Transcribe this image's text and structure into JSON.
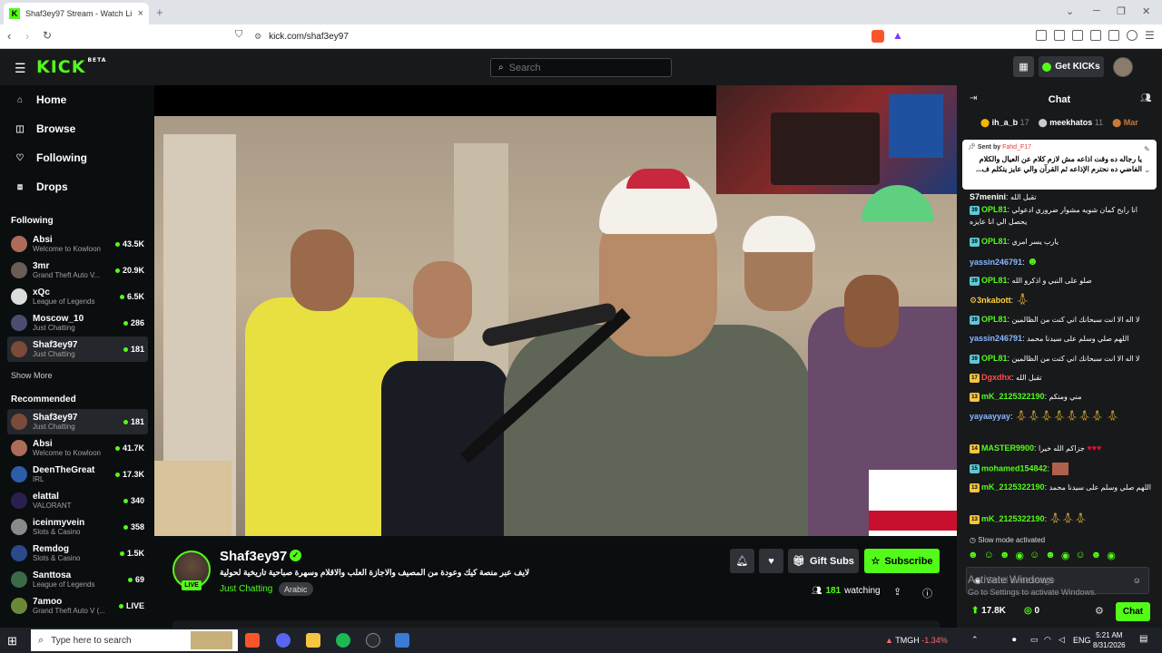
{
  "browser": {
    "tab_title": "Shaf3ey97 Stream - Watch Li",
    "tab_close": "×",
    "new_tab": "+",
    "url": "kick.com/shaf3ey97"
  },
  "kick": {
    "logo": "KICK",
    "logo_badge": "BETA",
    "search_placeholder": "Search",
    "get_kicks": "Get KICKs"
  },
  "sidebar": {
    "nav": [
      {
        "label": "Home",
        "icon": "home-icon"
      },
      {
        "label": "Browse",
        "icon": "browse-icon"
      },
      {
        "label": "Following",
        "icon": "heart-icon"
      },
      {
        "label": "Drops",
        "icon": "gift-icon"
      }
    ],
    "following_header": "Following",
    "following": [
      {
        "name": "Absi",
        "category": "Welcome to Kowloon",
        "viewers": "43.5K"
      },
      {
        "name": "3mr",
        "category": "Grand Theft Auto V...",
        "viewers": "20.9K"
      },
      {
        "name": "xQc",
        "category": "League of Legends",
        "viewers": "6.5K"
      },
      {
        "name": "Moscow_10",
        "category": "Just Chatting",
        "viewers": "286"
      },
      {
        "name": "Shaf3ey97",
        "category": "Just Chatting",
        "viewers": "181"
      }
    ],
    "show_more": "Show More",
    "recommended_header": "Recommended",
    "recommended": [
      {
        "name": "Shaf3ey97",
        "category": "Just Chatting",
        "viewers": "181"
      },
      {
        "name": "Absi",
        "category": "Welcome to Kowloon",
        "viewers": "41.7K"
      },
      {
        "name": "DeenTheGreat",
        "category": "IRL",
        "viewers": "17.3K"
      },
      {
        "name": "elattal",
        "category": "VALORANT",
        "viewers": "340"
      },
      {
        "name": "iceinmyvein",
        "category": "Slots & Casino",
        "viewers": "358"
      },
      {
        "name": "Remdog",
        "category": "Slots & Casino",
        "viewers": "1.5K"
      },
      {
        "name": "Santtosa",
        "category": "League of Legends",
        "viewers": "69"
      },
      {
        "name": "7amoo",
        "category": "Grand Theft Auto V (...",
        "viewers": "LIVE"
      }
    ]
  },
  "stream": {
    "streamer": "Shaf3ey97",
    "live_badge": "LIVE",
    "title": "لايف عبر منصة كيك وعودة من المصيف والاجازة العلب والاقلام وسهرة صباحية تاريخية لحولية",
    "category": "Just Chatting",
    "language": "Arabic",
    "gift_subs": "Gift Subs",
    "subscribe": "Subscribe",
    "viewers": "181",
    "watching_label": "watching"
  },
  "chat": {
    "header": "Chat",
    "leaders": [
      {
        "name": "ih_a_b",
        "count": "17"
      },
      {
        "name": "meekhatos",
        "count": "11"
      },
      {
        "name": "Mar",
        "count": ""
      }
    ],
    "pinned_by_label": "Sent by",
    "pinned_by_user": "Fahd_F17",
    "pinned_message": "يا رجاله ده وقت اذاعه مش لازم كلام عن العيال والكلام الفاضي ده نحترم الإذاعه ثم القرآن والي عايز يتكلم ف...",
    "messages": [
      {
        "badge": "",
        "user": "S7menini",
        "text": "تقبل الله",
        "color": "#ffffff"
      },
      {
        "badge": "39",
        "user": "OPL81",
        "text": "انا رايح كمان شويه مشوار ضروري ادعولي يحصل الي انا عايزه",
        "color": "#53fc18"
      },
      {
        "badge": "39",
        "user": "OPL81",
        "text": "يارب يسر امري",
        "color": "#53fc18"
      },
      {
        "badge": "",
        "user": "yassin246791",
        "text": "",
        "color": "#8bb7ff"
      },
      {
        "badge": "39",
        "user": "OPL81",
        "text": "صلو على النبي و اذكرو الله",
        "color": "#53fc18"
      },
      {
        "badge": "",
        "user": "3nkabott",
        "text": "",
        "color": "#ffd23d"
      },
      {
        "badge": "39",
        "user": "OPL81",
        "text": "لا اله الا انت سبحانك اني كنت من الظالمين",
        "color": "#53fc18"
      },
      {
        "badge": "",
        "user": "yassin246791",
        "text": "اللهم صلي وسلم على سيدنا محمد",
        "color": "#8bb7ff"
      },
      {
        "badge": "39",
        "user": "OPL81",
        "text": "لا اله الا انت سبحانك اني كنت من الظالمين",
        "color": "#53fc18"
      },
      {
        "badge": "17",
        "user": "Dgxdhx",
        "text": "تقبل الله",
        "color": "#ff4d4d"
      },
      {
        "badge": "13",
        "user": "mK_2125322190",
        "text": "مني ومنكم",
        "color": "#53fc18"
      },
      {
        "badge": "",
        "user": "yayaayyay",
        "text": "",
        "color": "#8bb7ff"
      },
      {
        "badge": "14",
        "user": "MASTER9900",
        "text": "جزاكم الله خيرا",
        "color": "#53fc18"
      },
      {
        "badge": "15",
        "user": "mohamed154842",
        "text": "",
        "color": "#53fc18"
      },
      {
        "badge": "13",
        "user": "mK_2125322190",
        "text": "اللهم صلي وسلم على سيدنا محمد",
        "color": "#53fc18"
      },
      {
        "badge": "13",
        "user": "mK_2125322190",
        "text": "",
        "color": "#53fc18"
      }
    ],
    "slow_mode": "Slow mode activated",
    "input_placeholder": "Send a message",
    "watermark_title": "Activate Windows",
    "watermark_sub": "Go to Settings to activate Windows.",
    "kicks_count": "17.8K",
    "zero_count": "0",
    "send_label": "Chat"
  },
  "taskbar": {
    "search_placeholder": "Type here to search",
    "stock_name": "TMGH",
    "stock_change": "-1.34%",
    "language": "ENG",
    "time": "5:21 AM",
    "date": "8/31/2026"
  },
  "colors": {
    "brand": "#53fc18",
    "bg": "#0b0e0f",
    "panel": "#18191b"
  }
}
